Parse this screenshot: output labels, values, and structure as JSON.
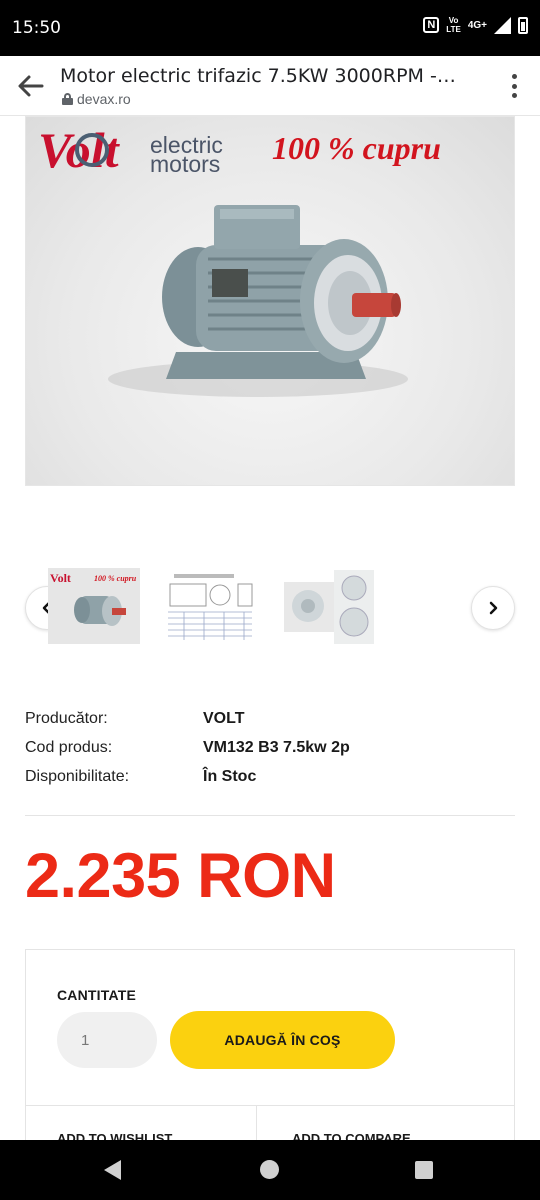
{
  "status_bar": {
    "time": "15:50",
    "nfc_label": "N",
    "volte_label": "Vo\nLTE",
    "network_label": "4G+"
  },
  "toolbar": {
    "title": "Motor electric trifazic 7.5KW 3000RPM - ...",
    "url": "devax.ro",
    "back_icon": "arrow-left-icon",
    "menu_icon": "more-vertical-icon"
  },
  "hero": {
    "brand_word": "Volt",
    "brand_sub_1": "electric",
    "brand_sub_2": "motors",
    "slogan": "100 % cupru"
  },
  "gallery": {
    "thumb_slogan": "100 % cupru",
    "prev_icon": "chevron-left-icon",
    "next_icon": "chevron-right-icon"
  },
  "specs": [
    {
      "label": "Producător:",
      "value": "VOLT"
    },
    {
      "label": "Cod produs:",
      "value": "VM132 B3 7.5kw 2p"
    },
    {
      "label": "Disponibilitate:",
      "value": "În Stoc"
    }
  ],
  "price": "2.235 RON",
  "cart": {
    "quantity_label": "CANTITATE",
    "quantity_value": "1",
    "add_button": "ADAUGĂ ÎN COŞ",
    "wishlist_link": "ADD TO WISHLIST",
    "compare_link": "ADD TO COMPARE"
  },
  "colors": {
    "price_red": "#ec2a16",
    "button_yellow": "#fbd10f",
    "brand_red": "#c8102e",
    "motor_grey": "#8fa2a8"
  }
}
